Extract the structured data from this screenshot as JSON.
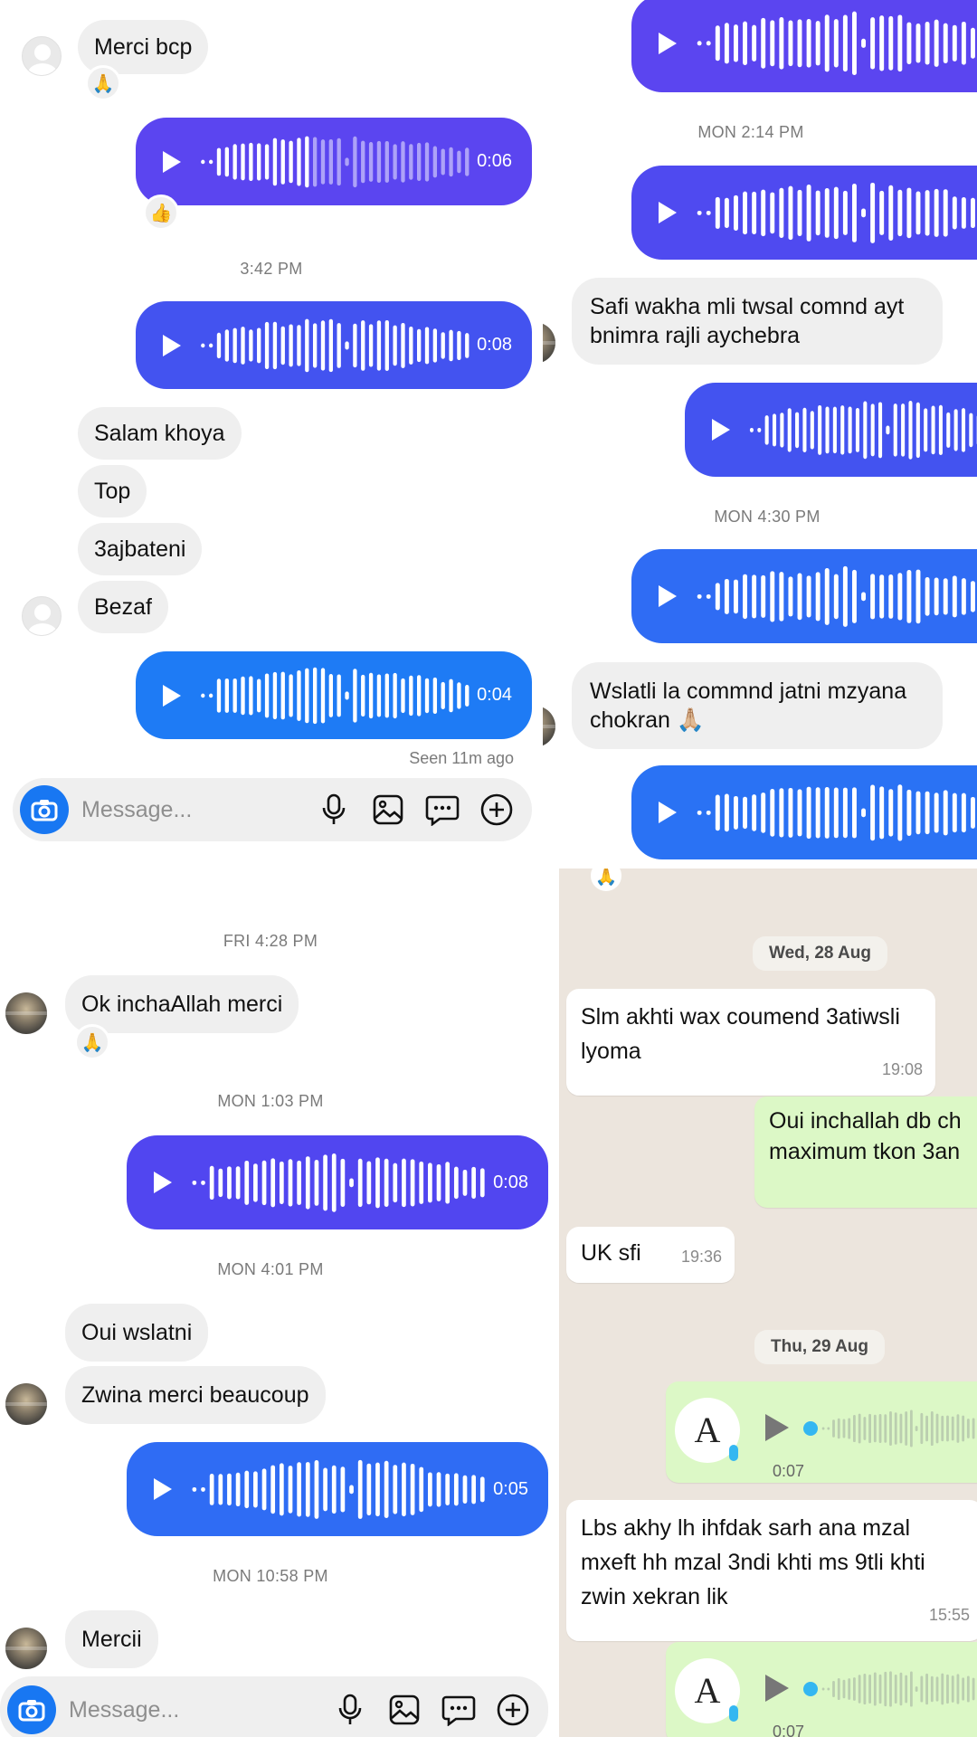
{
  "colors": {
    "purple": "#5b45f0",
    "indigo": "#4353f0",
    "blue": "#2f6cf4",
    "lightblue": "#1e7bf5",
    "wa_green": "#dcf8c6"
  },
  "p1": {
    "msg_merci": "Merci bcp",
    "react_pray": "🙏",
    "react_thumb": "👍",
    "v1_dur": "0:06",
    "ts1": "3:42 PM",
    "v2_dur": "0:08",
    "msg_salam": "Salam khoya",
    "msg_top": "Top",
    "msg_3ajb": "3ajbateni",
    "msg_bezaf": "Bezaf",
    "v3_dur": "0:04",
    "seen": "Seen 11m ago",
    "placeholder": "Message..."
  },
  "p2": {
    "ts1": "MON 2:14 PM",
    "msg_safi": "Safi wakha mli twsal comnd ayt bnimra rajli aychebra",
    "ts2": "MON 4:30 PM",
    "msg_wslatli": "Wslatli la commnd jatni mzyana chokran 🙏🏼"
  },
  "p3": {
    "ts1": "FRI 4:28 PM",
    "msg_ok": "Ok inchaAllah merci",
    "react_pray": "🙏",
    "ts2": "MON 1:03 PM",
    "v1_dur": "0:08",
    "ts3": "MON 4:01 PM",
    "msg_oui": "Oui wslatni",
    "msg_zwina": "Zwina merci beaucoup",
    "v2_dur": "0:05",
    "ts4": "MON 10:58 PM",
    "msg_mercii": "Mercii",
    "placeholder": "Message..."
  },
  "p4": {
    "react_pray": "🙏",
    "date1": "Wed, 28 Aug",
    "msg_slm": "Slm akhti wax coumend 3atiwsli lyoma",
    "time_slm": "19:08",
    "msg_oui": "Oui inchallah db ch maximum tkon 3an",
    "msg_uk": "UK sfi",
    "time_uk": "19:36",
    "date2": "Thu, 29 Aug",
    "v1_dur": "0:07",
    "msg_lbs": "Lbs akhy lh ihfdak sarh ana mzal mxeft hh mzal 3ndi khti ms 9tli khti zwin xekran lik",
    "time_lbs": "15:55",
    "v2_dur": "0:07"
  }
}
